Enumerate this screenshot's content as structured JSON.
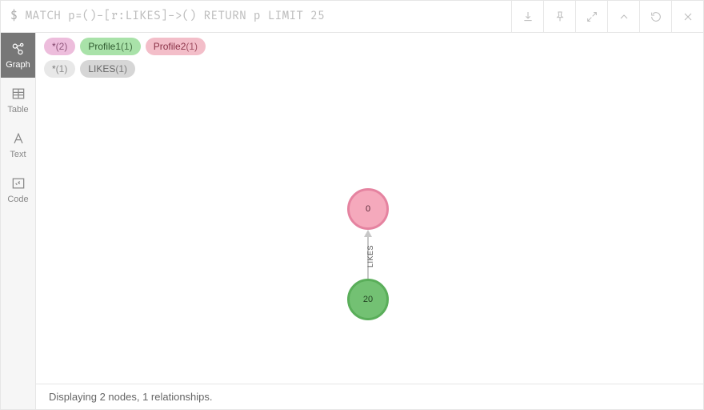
{
  "query": {
    "prompt": "$",
    "text": "MATCH p=()-[r:LIKES]->() RETURN p LIMIT 25"
  },
  "sidebar": {
    "graph": "Graph",
    "table": "Table",
    "text": "Text",
    "code": "Code"
  },
  "chips": {
    "nodes": [
      {
        "label": "*",
        "count": "(2)"
      },
      {
        "label": "Profile1",
        "count": "(1)"
      },
      {
        "label": "Profile2",
        "count": "(1)"
      }
    ],
    "rels": [
      {
        "label": "*",
        "count": "(1)"
      },
      {
        "label": "LIKES",
        "count": "(1)"
      }
    ]
  },
  "graph": {
    "node_top": "0",
    "node_bottom": "20",
    "edge_label": "LIKES"
  },
  "footer": "Displaying 2 nodes, 1 relationships."
}
